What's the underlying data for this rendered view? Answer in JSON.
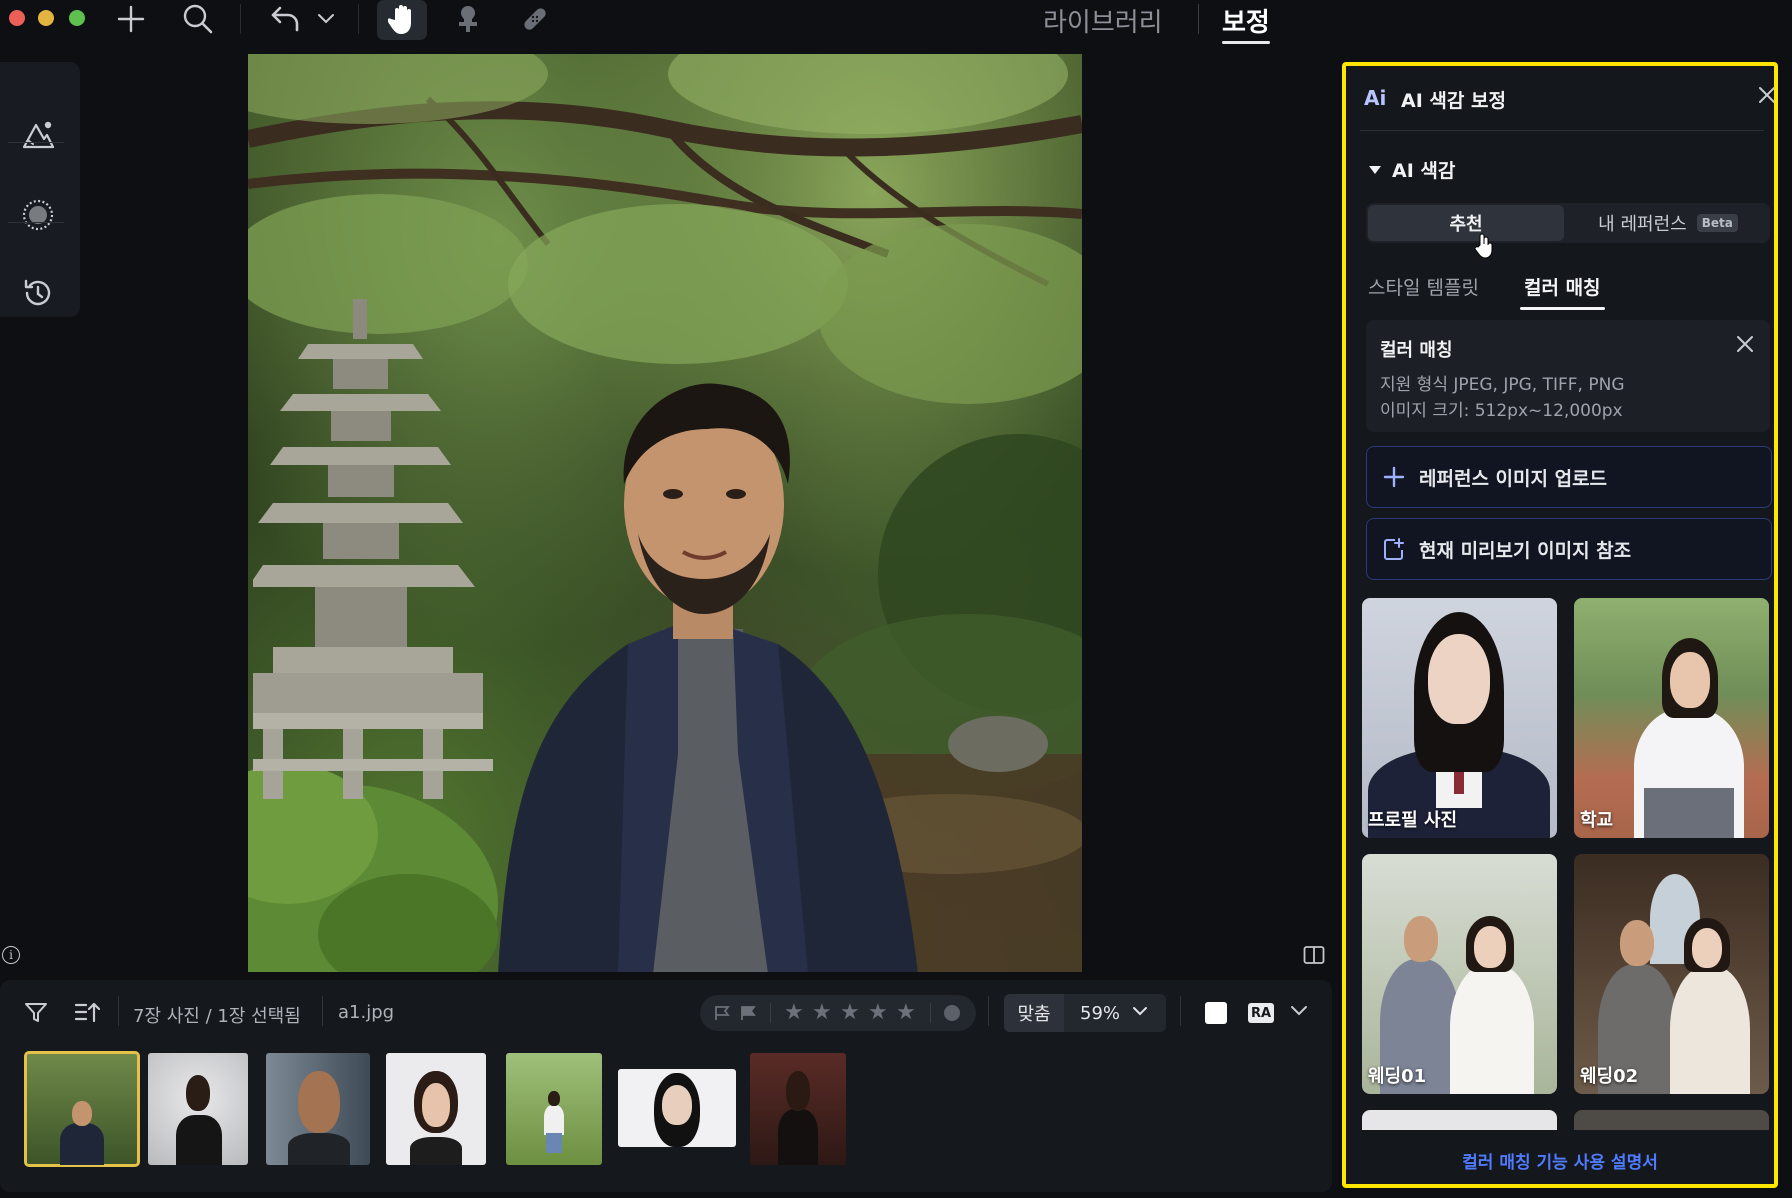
{
  "topbar": {
    "tabs": {
      "library": "라이브러리",
      "edit": "보정"
    }
  },
  "photo": {
    "file_name": "a1.jpg"
  },
  "bottom": {
    "count_text": "7장 사진 / 1장 선택됨",
    "file_text": "a1.jpg",
    "rating_stars": [
      "★",
      "★",
      "★",
      "★",
      "★"
    ],
    "fit_label": "맞춤",
    "zoom_label": "59%",
    "ra_label": "RA",
    "selected_thumbnail_index": 0,
    "thumbnail_count": 7
  },
  "panel": {
    "ai_logo": "Ai",
    "title": "AI 색감 보정",
    "section_title": "AI 색감",
    "segment": {
      "recommend": "추천",
      "my_reference": "내 레퍼런스",
      "beta": "Beta"
    },
    "subtabs": {
      "style_template": "스타일 템플릿",
      "color_matching": "컬러 매칭"
    },
    "info_card": {
      "title": "컬러 매칭",
      "line1": "지원 형식 JPEG, JPG, TIFF, PNG",
      "line2": "이미지 크기: 512px~12,000px"
    },
    "buttons": {
      "upload": "레퍼런스 이미지 업로드",
      "use_preview": "현재 미리보기 이미지 참조"
    },
    "cards": [
      {
        "caption": "프로필 사진"
      },
      {
        "caption": "학교"
      },
      {
        "caption": "웨딩01"
      },
      {
        "caption": "웨딩02"
      }
    ],
    "footer_link": "컬러 매칭 기능 사용 설명서"
  },
  "colors": {
    "highlight_border": "#ffe600",
    "selected_thumbnail": "#e4c24a",
    "link": "#4f7bff",
    "accent_button_border": "#2c3a7a"
  },
  "icons": [
    "plus-icon",
    "search-icon",
    "undo-icon",
    "chevron-down-icon",
    "hand-icon",
    "clone-stamp-icon",
    "bandage-icon",
    "mountain-ai-icon",
    "mask-icon",
    "history-icon",
    "info-icon",
    "compare-icon",
    "filter-icon",
    "sort-icon",
    "flag-icon",
    "close-icon",
    "triangle-down-icon",
    "upload-plus-icon",
    "export-square-icon"
  ]
}
